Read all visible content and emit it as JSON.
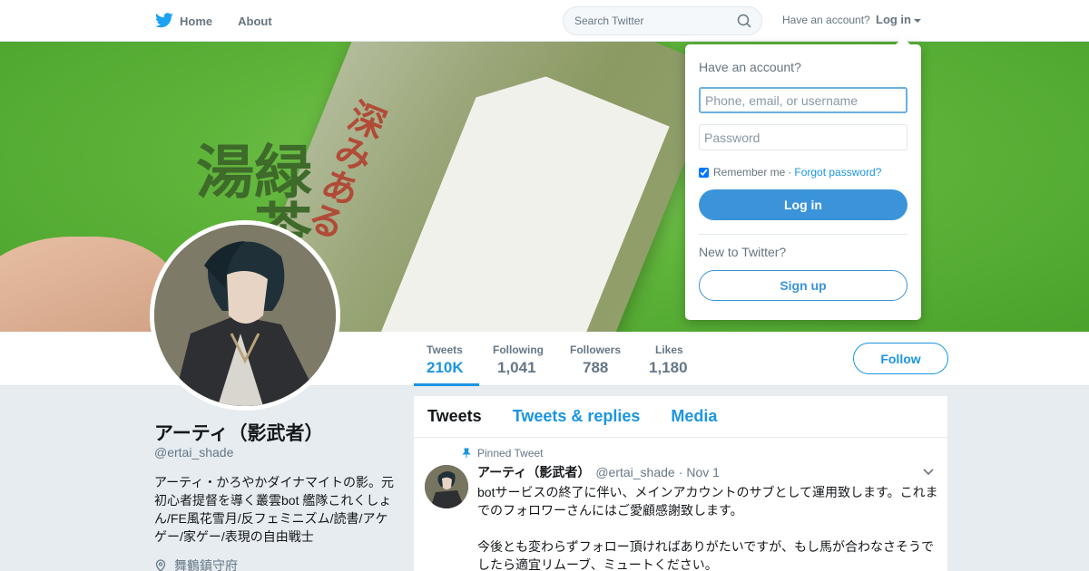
{
  "nav": {
    "home_label": "Home",
    "about_label": "About",
    "search_placeholder": "Search Twitter",
    "have_account": "Have an account?",
    "login_label": "Log in"
  },
  "dropdown": {
    "title": "Have an account?",
    "username_placeholder": "Phone, email, or username",
    "password_placeholder": "Password",
    "remember_label": "Remember me",
    "separator": "·",
    "forgot_label": "Forgot password?",
    "login_button": "Log in",
    "new_label": "New to Twitter?",
    "signup_button": "Sign up"
  },
  "banner": {
    "kanji_big": "緑茶の湯",
    "kanji_red": "深みある"
  },
  "stats": [
    {
      "label": "Tweets",
      "value": "210K"
    },
    {
      "label": "Following",
      "value": "1,041"
    },
    {
      "label": "Followers",
      "value": "788"
    },
    {
      "label": "Likes",
      "value": "1,180"
    }
  ],
  "follow_label": "Follow",
  "profile": {
    "name": "アーティ（影武者）",
    "handle": "@ertai_shade",
    "bio": "アーティ・かろやかダイナマイトの影。元初心者提督を導く叢雲bot 艦隊これくしょん/FE風花雪月/反フェミニズム/読書/アケゲー/家ゲー/表現の自由戦士",
    "location": "舞鶴鎮守府"
  },
  "timeline": {
    "tabs": [
      "Tweets",
      "Tweets & replies",
      "Media"
    ],
    "pinned_label": "Pinned Tweet",
    "tweet": {
      "name": "アーティ（影武者）",
      "handle": "@ertai_shade",
      "dot": "·",
      "date": "Nov 1",
      "text": "botサービスの終了に伴い、メインアカウントのサブとして運用致します。これまでのフォロワーさんにはご愛顧感謝致します。\n\n今後とも変わらずフォロー頂ければありがたいですが、もし馬が合わなさそうでしたら適宜リムーブ、ミュートください。"
    }
  },
  "colors": {
    "accent": "#1b95e0",
    "banner_green": "#5fb43a"
  }
}
